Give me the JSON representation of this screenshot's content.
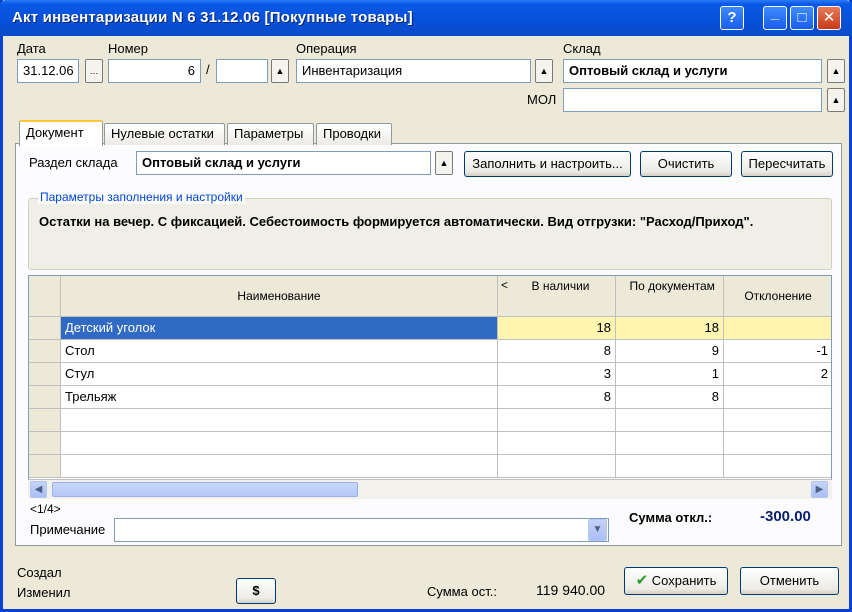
{
  "window": {
    "title": "Акт инвентаризации N 6 31.12.06 [Покупные товары]",
    "help_btn": "?",
    "min_btn": "_",
    "max_btn": "□",
    "close_btn": "✕"
  },
  "header": {
    "date_label": "Дата",
    "date_value": "31.12.06",
    "number_label": "Номер",
    "number_value": "6",
    "number_separator": "/",
    "number_suffix": "",
    "operation_label": "Операция",
    "operation_value": "Инвентаризация",
    "warehouse_label": "Склад",
    "warehouse_value": "Оптовый склад и услуги",
    "mol_label": "МОЛ",
    "mol_value": ""
  },
  "tabs": [
    {
      "label": "Документ"
    },
    {
      "label": "Нулевые остатки"
    },
    {
      "label": "Параметры"
    },
    {
      "label": "Проводки"
    }
  ],
  "doc": {
    "section_label": "Раздел склада",
    "section_value": "Оптовый склад и услуги",
    "fill_btn": "Заполнить и настроить...",
    "clear_btn": "Очистить",
    "recalc_btn": "Пересчитать",
    "params_title": "Параметры заполнения и настройки",
    "params_text": "Остатки на вечер. С фиксацией. Себестоимость формируется автоматически. Вид отгрузки: \"Расход/Приход\"."
  },
  "grid": {
    "columns": [
      "Наименование",
      "В наличии",
      "По документам",
      "Отклонение"
    ],
    "scroll_left": "<",
    "rows": [
      {
        "name": "Детский уголок",
        "actual": "18",
        "docs": "18",
        "diff": ""
      },
      {
        "name": "Стол",
        "actual": "8",
        "docs": "9",
        "diff": "-1"
      },
      {
        "name": "Стул",
        "actual": "3",
        "docs": "1",
        "diff": "2"
      },
      {
        "name": "Трельяж",
        "actual": "8",
        "docs": "8",
        "diff": ""
      }
    ]
  },
  "footer": {
    "page_counter": "<1/4>",
    "sum_diff_label": "Сумма откл.:",
    "sum_diff_value": "-300.00",
    "note_label": "Примечание",
    "note_value": "",
    "created_label": "Создал",
    "changed_label": "Изменил",
    "dollar_btn": "$",
    "sum_rest_label": "Сумма ост.:",
    "sum_rest_value": "119 940.00",
    "save_btn": "Сохранить",
    "cancel_btn": "Отменить"
  },
  "colors": {
    "titlebar": "#0550d8",
    "selected_row": "#316ac5",
    "highlight_cell": "#fff5b0",
    "save_check": "#2e9b2e"
  }
}
